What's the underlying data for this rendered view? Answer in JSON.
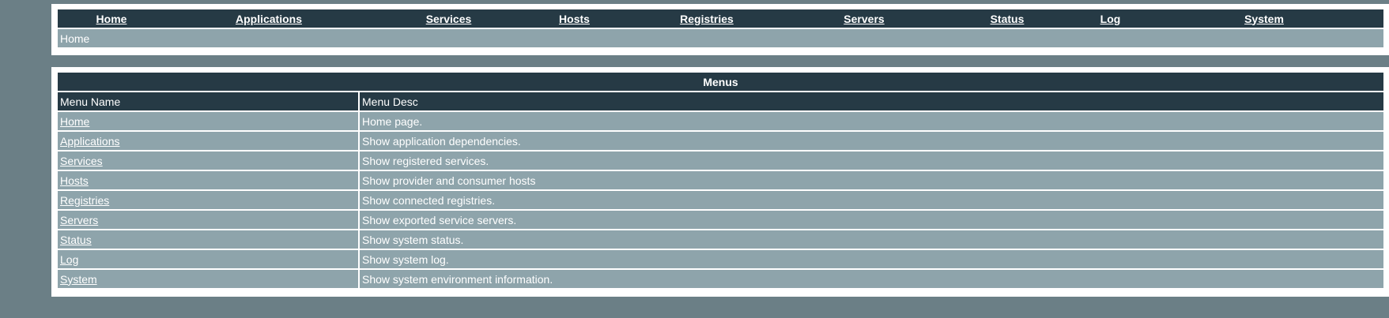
{
  "nav": {
    "items": [
      {
        "label": "Home"
      },
      {
        "label": "Applications"
      },
      {
        "label": "Services"
      },
      {
        "label": "Hosts"
      },
      {
        "label": "Registries"
      },
      {
        "label": "Servers"
      },
      {
        "label": "Status"
      },
      {
        "label": "Log"
      },
      {
        "label": "System"
      }
    ]
  },
  "breadcrumb": {
    "current": "Home"
  },
  "menus": {
    "title": "Menus",
    "columns": [
      "Menu Name",
      "Menu Desc"
    ],
    "rows": [
      {
        "name": "Home",
        "desc": "Home page."
      },
      {
        "name": "Applications",
        "desc": "Show application dependencies."
      },
      {
        "name": "Services",
        "desc": "Show registered services."
      },
      {
        "name": "Hosts",
        "desc": "Show provider and consumer hosts"
      },
      {
        "name": "Registries",
        "desc": "Show connected registries."
      },
      {
        "name": "Servers",
        "desc": "Show exported service servers."
      },
      {
        "name": "Status",
        "desc": "Show system status."
      },
      {
        "name": "Log",
        "desc": "Show system log."
      },
      {
        "name": "System",
        "desc": "Show system environment information."
      }
    ]
  }
}
